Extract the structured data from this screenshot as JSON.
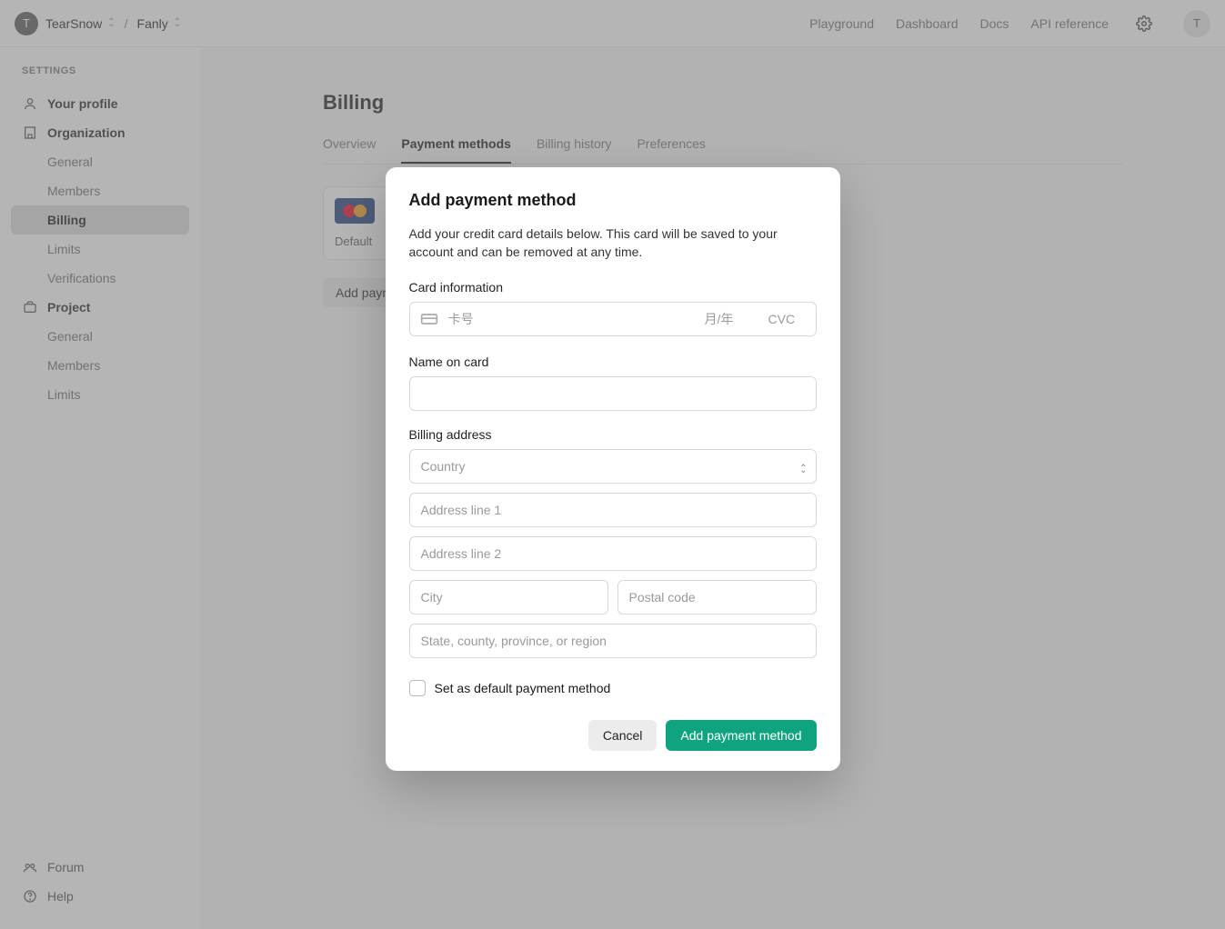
{
  "topbar": {
    "avatar_initial": "T",
    "org_name": "TearSnow",
    "project_name": "Fanly",
    "links": {
      "playground": "Playground",
      "dashboard": "Dashboard",
      "docs": "Docs",
      "api_reference": "API reference"
    },
    "user_initial": "T"
  },
  "sidebar": {
    "heading": "SETTINGS",
    "your_profile": "Your profile",
    "organization": "Organization",
    "org_children": {
      "general": "General",
      "members": "Members",
      "billing": "Billing",
      "limits": "Limits",
      "verifications": "Verifications"
    },
    "project": "Project",
    "project_children": {
      "general": "General",
      "members": "Members",
      "limits": "Limits"
    },
    "forum": "Forum",
    "help": "Help"
  },
  "page": {
    "title": "Billing",
    "tabs": {
      "overview": "Overview",
      "payment_methods": "Payment methods",
      "billing_history": "Billing history",
      "preferences": "Preferences"
    },
    "card_default": "Default",
    "add_button": "Add payment method"
  },
  "modal": {
    "title": "Add payment method",
    "description": "Add your credit card details below. This card will be saved to your account and can be removed at any time.",
    "card_label": "Card information",
    "card_number_ph": "卡号",
    "card_exp_ph": "月/年",
    "card_cvc_ph": "CVC",
    "name_label": "Name on card",
    "billing_label": "Billing address",
    "country_ph": "Country",
    "addr1_ph": "Address line 1",
    "addr2_ph": "Address line 2",
    "city_ph": "City",
    "postal_ph": "Postal code",
    "state_ph": "State, county, province, or region",
    "default_checkbox": "Set as default payment method",
    "cancel": "Cancel",
    "submit": "Add payment method"
  }
}
